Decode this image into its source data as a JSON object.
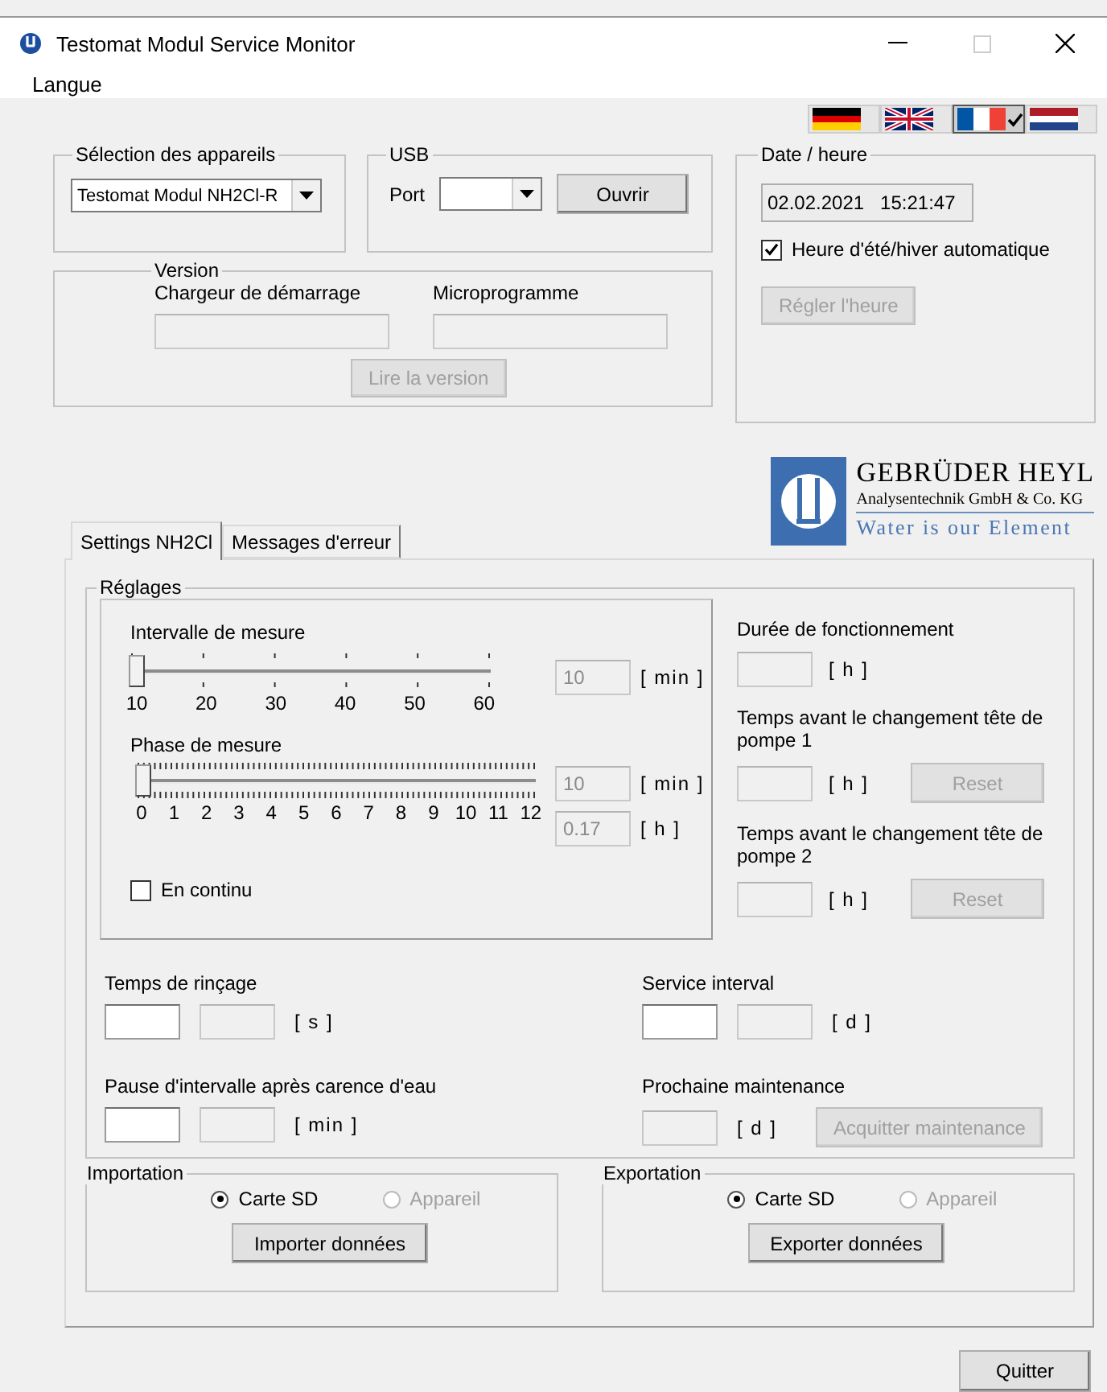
{
  "window": {
    "title": "Testomat Modul Service Monitor"
  },
  "menu": [
    {
      "label": "Langue"
    }
  ],
  "languages": [
    {
      "kind": "german",
      "selected": false
    },
    {
      "kind": "british",
      "selected": false
    },
    {
      "kind": "french",
      "selected": true
    },
    {
      "kind": "dutch",
      "selected": false
    }
  ],
  "device_selection": {
    "title": "Sélection des appareils",
    "value": "Testomat Modul NH2Cl-R"
  },
  "usb": {
    "title": "USB",
    "port_label": "Port",
    "open_button": "Ouvrir"
  },
  "version": {
    "title": "Version",
    "fields": [
      {
        "label": "Chargeur de démarrage"
      },
      {
        "label": "Microprogramme"
      }
    ],
    "read_button": {
      "label": "Lire la version",
      "disabled": true
    }
  },
  "date_time": {
    "title": "Date / heure",
    "value": "02.02.2021   15:21:47",
    "auto_dst": {
      "label": "Heure d'été/hiver automatique",
      "checked": true
    },
    "set_button": {
      "label": "Régler l'heure",
      "disabled": true
    }
  },
  "logo": {
    "name": "GEBRÜDER HEYL",
    "subtitle": "Analysentechnik GmbH & Co. KG",
    "slogan": "Water is our Element"
  },
  "tabs": [
    {
      "label": "Settings NH2Cl",
      "selected": true
    },
    {
      "label": "Messages d'erreur",
      "selected": false
    }
  ],
  "settings": {
    "title": "Réglages",
    "interval": {
      "label": "Intervalle de mesure",
      "level": 0,
      "ticks": [
        "10",
        "20",
        "30",
        "40",
        "50",
        "60"
      ],
      "field": {
        "value": "10",
        "disabled": true
      },
      "unit": "[ min ]"
    },
    "phase": {
      "label": "Phase de mesure",
      "level": 0,
      "ticks": [
        "0",
        "1",
        "2",
        "3",
        "4",
        "5",
        "6",
        "7",
        "8",
        "9",
        "10",
        "11",
        "12"
      ],
      "fields": [
        {
          "value": "10",
          "disabled": true,
          "unit": "[ min ]"
        },
        {
          "value": "0.17",
          "disabled": true,
          "unit": "[ h ]"
        }
      ]
    },
    "continuous": {
      "label": "En continu",
      "checked": false
    },
    "counters": [
      {
        "label": "Durée de fonctionnement",
        "field": {
          "disabled": true
        },
        "unit": "[ h ]"
      },
      {
        "label": "Temps avant le changement tête de pompe 1",
        "field": {
          "disabled": true
        },
        "unit": "[ h ]",
        "reset_button": {
          "label": "Reset",
          "disabled": true
        }
      },
      {
        "label": "Temps avant le changement tête de pompe 2",
        "field": {
          "disabled": true
        },
        "unit": "[ h ]",
        "reset_button": {
          "label": "Reset",
          "disabled": true
        }
      }
    ],
    "rinse": {
      "label": "Temps de rinçage",
      "fields": [
        {
          "disabled": false
        },
        {
          "disabled": true
        }
      ],
      "unit": "[ s ]"
    },
    "pause": {
      "label": "Pause d'intervalle après carence d'eau",
      "fields": [
        {
          "disabled": false
        },
        {
          "disabled": true
        }
      ],
      "unit": "[ min ]"
    },
    "service_interval": {
      "label": "Service interval",
      "fields": [
        {
          "disabled": false
        },
        {
          "disabled": true
        }
      ],
      "unit": "[ d ]"
    },
    "next_maintenance": {
      "label": "Prochaine maintenance",
      "fields": [
        {
          "disabled": true
        }
      ],
      "unit": "[ d ]",
      "ack_button": {
        "label": "Acquitter maintenance",
        "disabled": true
      }
    }
  },
  "import": {
    "title": "Importation",
    "options": [
      {
        "label": "Carte SD",
        "selected": true,
        "disabled": false
      },
      {
        "label": "Appareil",
        "selected": false,
        "disabled": true
      }
    ],
    "button": "Importer données"
  },
  "export": {
    "title": "Exportation",
    "options": [
      {
        "label": "Carte SD",
        "selected": true,
        "disabled": false
      },
      {
        "label": "Appareil",
        "selected": false,
        "disabled": true
      }
    ],
    "button": "Exporter données"
  },
  "quit_button": "Quitter"
}
